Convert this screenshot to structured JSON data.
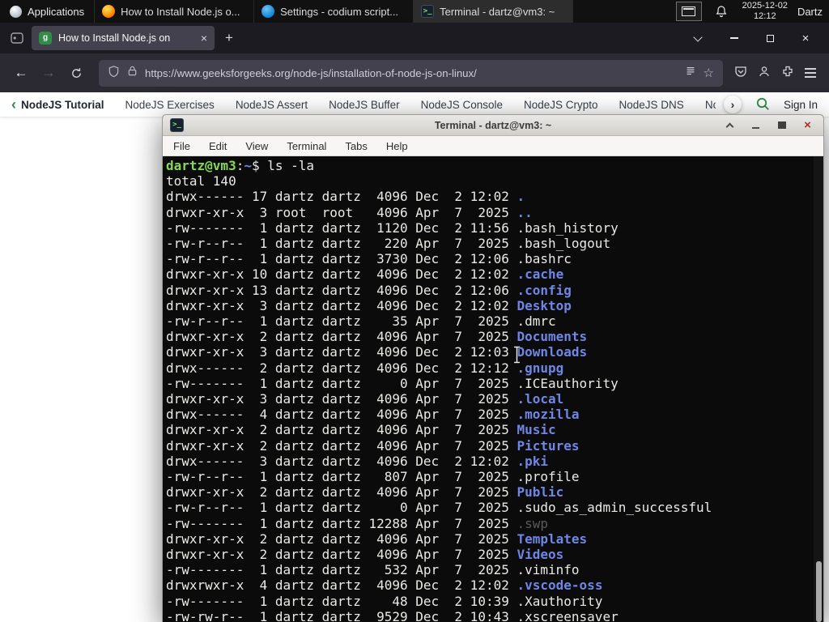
{
  "panel": {
    "applications_label": "Applications",
    "tasks": [
      {
        "icon": "firefox",
        "title": "How to Install Node.js o...",
        "active": false
      },
      {
        "icon": "codium",
        "title": "Settings - codium script...",
        "active": false
      },
      {
        "icon": "terminal",
        "title": "Terminal - dartz@vm3: ~",
        "active": true
      }
    ],
    "clock_date": "2025-12-02",
    "clock_time": "12:12",
    "user": "Dartz"
  },
  "glyphs": {
    "back": "←",
    "forward": "→",
    "plus": "+",
    "close": "×",
    "star": "☆",
    "chev_left": "‹",
    "chev_right": "›",
    "favicon_letter": "g",
    "terminal_prompt_icon": ">_"
  },
  "browser": {
    "tab_title": "How to Install Node.js on",
    "url": "https://www.geeksforgeeks.org/node-js/installation-of-node-js-on-linux/",
    "nav_strip": {
      "back_label": "NodeJS Tutorial",
      "items": [
        "NodeJS Exercises",
        "NodeJS Assert",
        "NodeJS Buffer",
        "NodeJS Console",
        "NodeJS Crypto",
        "NodeJS DNS",
        "Node"
      ],
      "sign_in": "Sign In"
    }
  },
  "terminal": {
    "title": "Terminal - dartz@vm3: ~",
    "menu": [
      "File",
      "Edit",
      "View",
      "Terminal",
      "Tabs",
      "Help"
    ],
    "colors": {
      "background": "#0b0b0b",
      "foreground": "#e9e9e5",
      "prompt_green": "#87d952",
      "dir_blue": "#6e87e6",
      "dim": "#5a5a5a"
    },
    "lines": [
      {
        "segs": [
          {
            "t": "dartz@vm3",
            "c": "green"
          },
          {
            "t": ":",
            "c": "fg"
          },
          {
            "t": "~",
            "c": "blue"
          },
          {
            "t": "$ ",
            "c": "fg"
          },
          {
            "t": "ls -la",
            "c": "fg"
          }
        ]
      },
      {
        "segs": [
          {
            "t": "total 140",
            "c": "fg"
          }
        ]
      },
      {
        "segs": [
          {
            "t": "drwx------ 17 dartz dartz  4096 Dec  2 12:02 ",
            "c": "fg"
          },
          {
            "t": ".",
            "c": "dir"
          }
        ]
      },
      {
        "segs": [
          {
            "t": "drwxr-xr-x  3 root  root   4096 Apr  7  2025 ",
            "c": "fg"
          },
          {
            "t": "..",
            "c": "dir"
          }
        ]
      },
      {
        "segs": [
          {
            "t": "-rw-------  1 dartz dartz  1120 Dec  2 11:56 .bash_history",
            "c": "fg"
          }
        ]
      },
      {
        "segs": [
          {
            "t": "-rw-r--r--  1 dartz dartz   220 Apr  7  2025 .bash_logout",
            "c": "fg"
          }
        ]
      },
      {
        "segs": [
          {
            "t": "-rw-r--r--  1 dartz dartz  3730 Dec  2 12:06 .bashrc",
            "c": "fg"
          }
        ]
      },
      {
        "segs": [
          {
            "t": "drwxr-xr-x 10 dartz dartz  4096 Dec  2 12:02 ",
            "c": "fg"
          },
          {
            "t": ".cache",
            "c": "dir"
          }
        ]
      },
      {
        "segs": [
          {
            "t": "drwxr-xr-x 13 dartz dartz  4096 Dec  2 12:06 ",
            "c": "fg"
          },
          {
            "t": ".config",
            "c": "dir"
          }
        ]
      },
      {
        "segs": [
          {
            "t": "drwxr-xr-x  3 dartz dartz  4096 Dec  2 12:02 ",
            "c": "fg"
          },
          {
            "t": "Desktop",
            "c": "dir"
          }
        ]
      },
      {
        "segs": [
          {
            "t": "-rw-r--r--  1 dartz dartz    35 Apr  7  2025 .dmrc",
            "c": "fg"
          }
        ]
      },
      {
        "segs": [
          {
            "t": "drwxr-xr-x  2 dartz dartz  4096 Apr  7  2025 ",
            "c": "fg"
          },
          {
            "t": "Documents",
            "c": "dir"
          }
        ]
      },
      {
        "segs": [
          {
            "t": "drwxr-xr-x  3 dartz dartz  4096 Dec  2 12:03 ",
            "c": "fg"
          },
          {
            "t": "Downloads",
            "c": "dir"
          }
        ]
      },
      {
        "segs": [
          {
            "t": "drwx------  2 dartz dartz  4096 Dec  2 12:12 ",
            "c": "fg"
          },
          {
            "t": ".gnupg",
            "c": "dir"
          }
        ]
      },
      {
        "segs": [
          {
            "t": "-rw-------  1 dartz dartz     0 Apr  7  2025 .ICEauthority",
            "c": "fg"
          }
        ]
      },
      {
        "segs": [
          {
            "t": "drwxr-xr-x  3 dartz dartz  4096 Apr  7  2025 ",
            "c": "fg"
          },
          {
            "t": ".local",
            "c": "dir"
          }
        ]
      },
      {
        "segs": [
          {
            "t": "drwx------  4 dartz dartz  4096 Apr  7  2025 ",
            "c": "fg"
          },
          {
            "t": ".mozilla",
            "c": "dir"
          }
        ]
      },
      {
        "segs": [
          {
            "t": "drwxr-xr-x  2 dartz dartz  4096 Apr  7  2025 ",
            "c": "fg"
          },
          {
            "t": "Music",
            "c": "dir"
          }
        ]
      },
      {
        "segs": [
          {
            "t": "drwxr-xr-x  2 dartz dartz  4096 Apr  7  2025 ",
            "c": "fg"
          },
          {
            "t": "Pictures",
            "c": "dir"
          }
        ]
      },
      {
        "segs": [
          {
            "t": "drwx------  3 dartz dartz  4096 Dec  2 12:02 ",
            "c": "fg"
          },
          {
            "t": ".pki",
            "c": "dir"
          }
        ]
      },
      {
        "segs": [
          {
            "t": "-rw-r--r--  1 dartz dartz   807 Apr  7  2025 .profile",
            "c": "fg"
          }
        ]
      },
      {
        "segs": [
          {
            "t": "drwxr-xr-x  2 dartz dartz  4096 Apr  7  2025 ",
            "c": "fg"
          },
          {
            "t": "Public",
            "c": "dir"
          }
        ]
      },
      {
        "segs": [
          {
            "t": "-rw-r--r--  1 dartz dartz     0 Apr  7  2025 .sudo_as_admin_successful",
            "c": "fg"
          }
        ]
      },
      {
        "segs": [
          {
            "t": "-rw-------  1 dartz dartz 12288 Apr  7  2025 ",
            "c": "fg"
          },
          {
            "t": ".swp",
            "c": "dim"
          }
        ]
      },
      {
        "segs": [
          {
            "t": "drwxr-xr-x  2 dartz dartz  4096 Apr  7  2025 ",
            "c": "fg"
          },
          {
            "t": "Templates",
            "c": "dir"
          }
        ]
      },
      {
        "segs": [
          {
            "t": "drwxr-xr-x  2 dartz dartz  4096 Apr  7  2025 ",
            "c": "fg"
          },
          {
            "t": "Videos",
            "c": "dir"
          }
        ]
      },
      {
        "segs": [
          {
            "t": "-rw-------  1 dartz dartz   532 Apr  7  2025 .viminfo",
            "c": "fg"
          }
        ]
      },
      {
        "segs": [
          {
            "t": "drwxrwxr-x  4 dartz dartz  4096 Dec  2 12:02 ",
            "c": "fg"
          },
          {
            "t": ".vscode-oss",
            "c": "dir"
          }
        ]
      },
      {
        "segs": [
          {
            "t": "-rw-------  1 dartz dartz    48 Dec  2 10:39 .Xauthority",
            "c": "fg"
          }
        ]
      },
      {
        "segs": [
          {
            "t": "-rw-rw-r--  1 dartz dartz  9529 Dec  2 10:43 .xscreensaver",
            "c": "fg"
          }
        ]
      }
    ]
  }
}
